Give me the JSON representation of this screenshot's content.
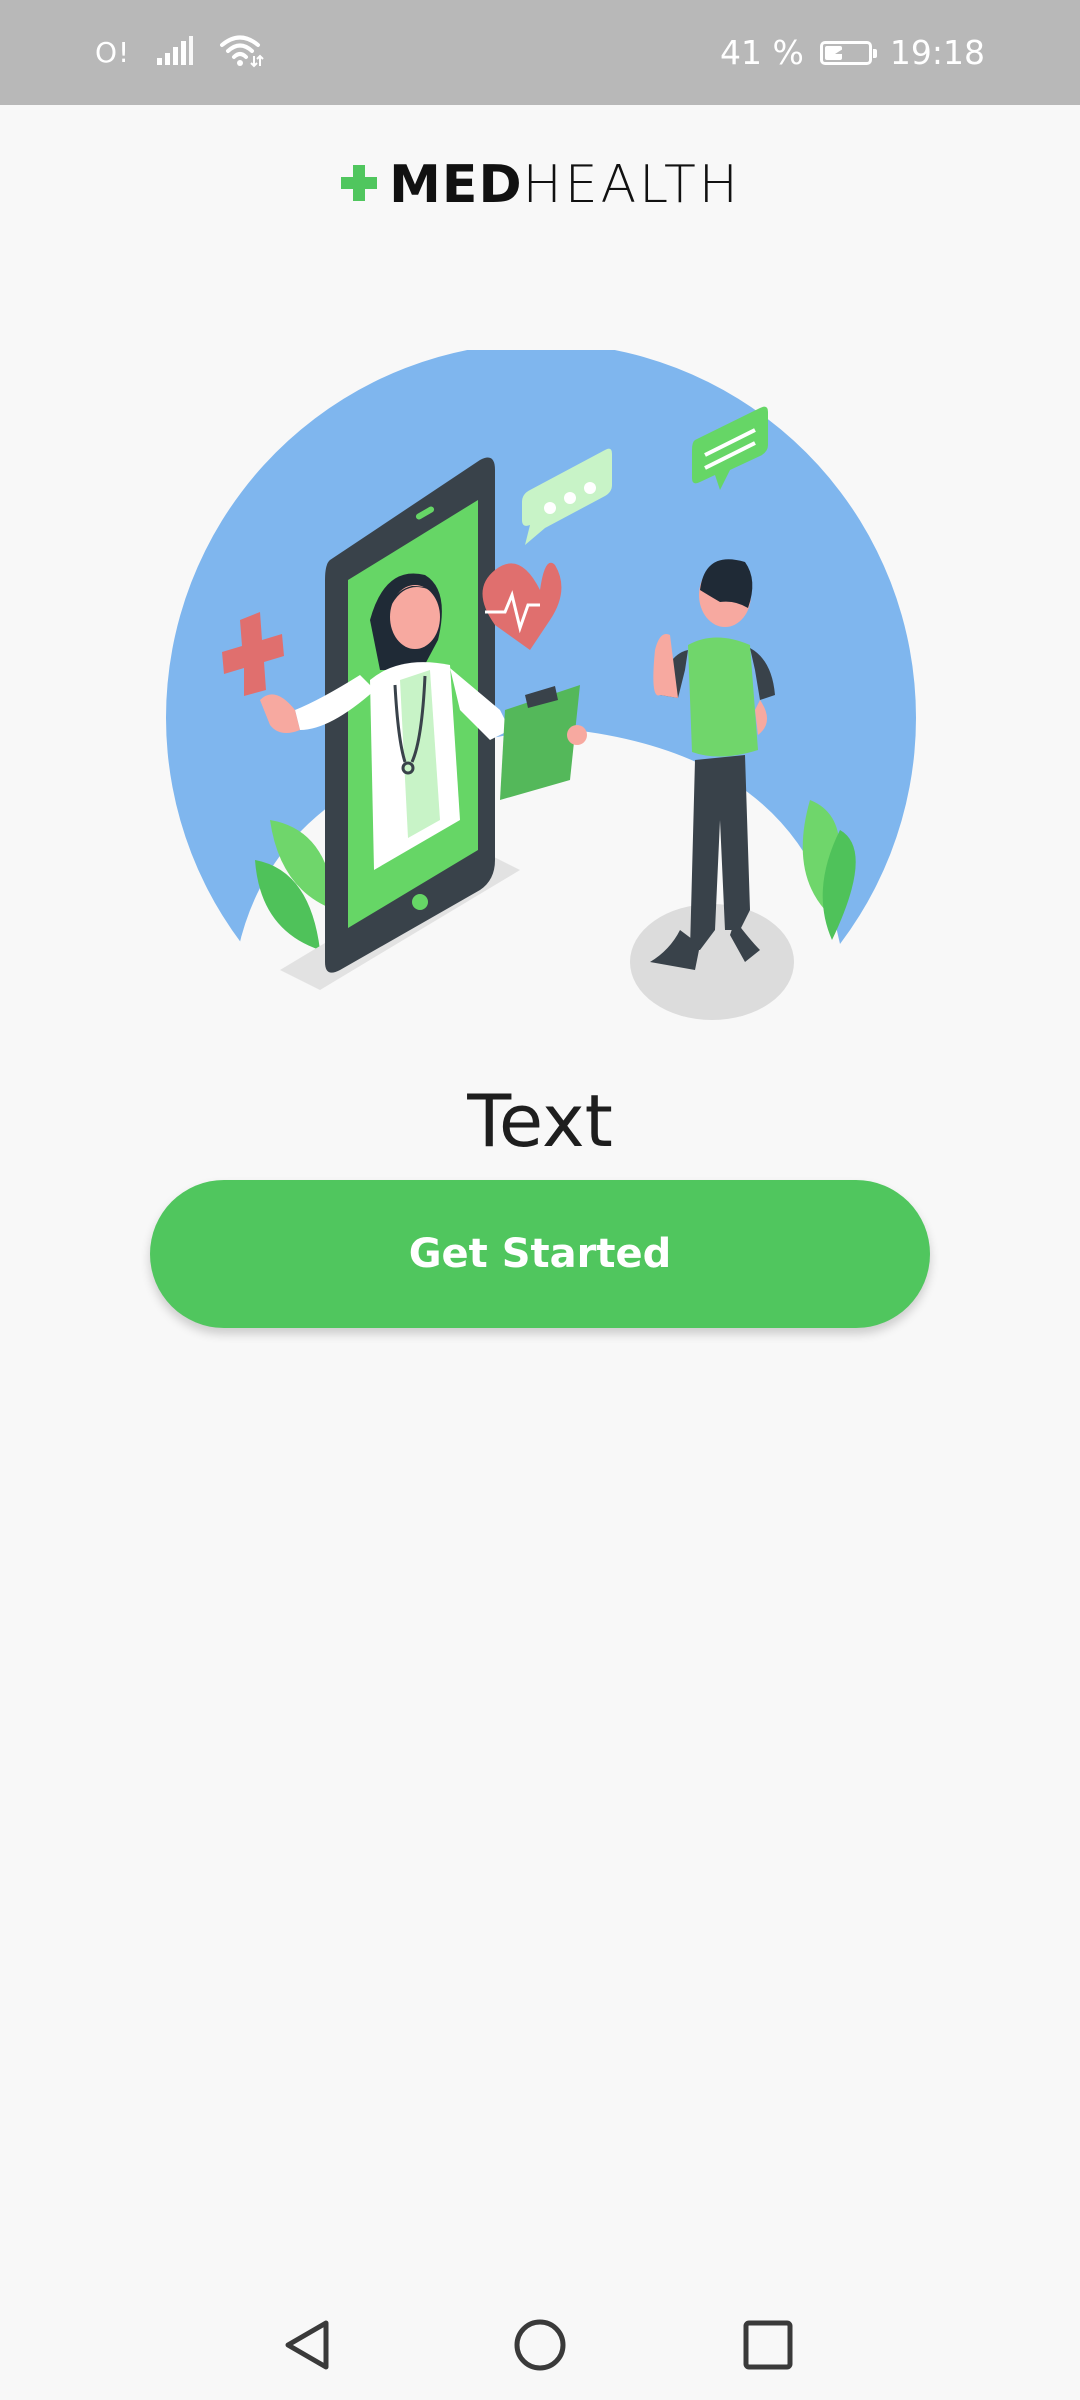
{
  "status_bar": {
    "carrier": "O!",
    "battery_percent": "41 %",
    "battery_level": 0.41,
    "time": "19:18"
  },
  "logo": {
    "part1": "MED",
    "part2": "HEALTH",
    "cross_color": "#50c65e"
  },
  "main": {
    "headline": "Text",
    "cta_label": "Get Started"
  },
  "colors": {
    "accent": "#50c65e",
    "illustration_blue": "#7fb6ee",
    "status_bar_bg": "#b8b8b8"
  },
  "nav_bar": {
    "icons": [
      "back-icon",
      "home-icon",
      "recents-icon"
    ]
  }
}
